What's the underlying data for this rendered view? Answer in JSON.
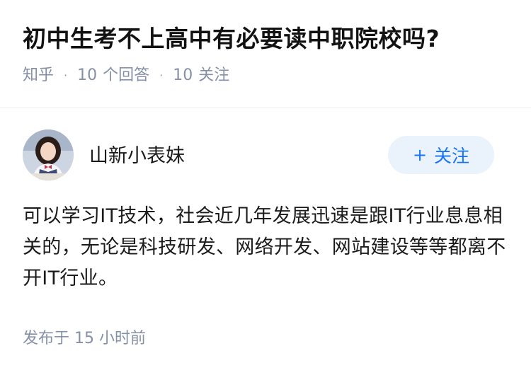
{
  "question": {
    "title": "初中生考不上高中有必要读中职院校吗?",
    "source": "知乎",
    "answer_count": "10",
    "answer_label": "个回答",
    "follow_count": "10",
    "follow_label": "关注",
    "separator": "·"
  },
  "answer": {
    "author_name": "山新小表妹",
    "follow_button_label": "关注",
    "follow_button_icon": "plus-icon",
    "content": "可以学习IT技术，社会近几年发展迅速是跟IT行业息息相关的，无论是科技研发、网络开发、网站建设等等都离不开IT行业。",
    "published_label": "发布于",
    "published_time": "15 小时前"
  },
  "colors": {
    "accent": "#1772f6",
    "button_bg": "#eaf2fc",
    "meta_text": "#8590a6",
    "divider": "#ececec"
  }
}
